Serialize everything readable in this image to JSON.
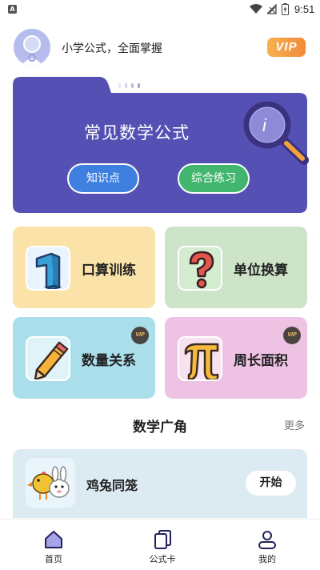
{
  "status_bar": {
    "time": "9:51",
    "app_icon_letter": "A"
  },
  "header": {
    "tagline": "小学公式，全面掌握",
    "vip_label": "VIP"
  },
  "hero": {
    "title": "常见数学公式",
    "buttons": [
      {
        "label": "知识点"
      },
      {
        "label": "综合练习"
      }
    ],
    "colors": {
      "background": "#5551b4",
      "knowledge_btn": "#3e7fe0",
      "practice_btn": "#42b56e"
    }
  },
  "cards": [
    {
      "label": "口算训练",
      "icon": "number-one-icon",
      "vip": false,
      "color": "#fbe2a8"
    },
    {
      "label": "单位换算",
      "icon": "question-mark-icon",
      "vip": false,
      "color": "#cde4c8"
    },
    {
      "label": "数量关系",
      "icon": "pencil-icon",
      "vip": true,
      "color": "#a9deea"
    },
    {
      "label": "周长面积",
      "icon": "pi-icon",
      "vip": true,
      "color": "#eec2e2"
    }
  ],
  "vip_coin_label": "VIP",
  "section": {
    "title": "数学广角",
    "more": "更多",
    "items": [
      {
        "label": "鸡兔同笼",
        "action": "开始"
      }
    ]
  },
  "tabbar": {
    "items": [
      {
        "label": "首页",
        "icon": "home-icon",
        "active": true
      },
      {
        "label": "公式卡",
        "icon": "cards-icon",
        "active": false
      },
      {
        "label": "我的",
        "icon": "user-icon",
        "active": false
      }
    ]
  }
}
